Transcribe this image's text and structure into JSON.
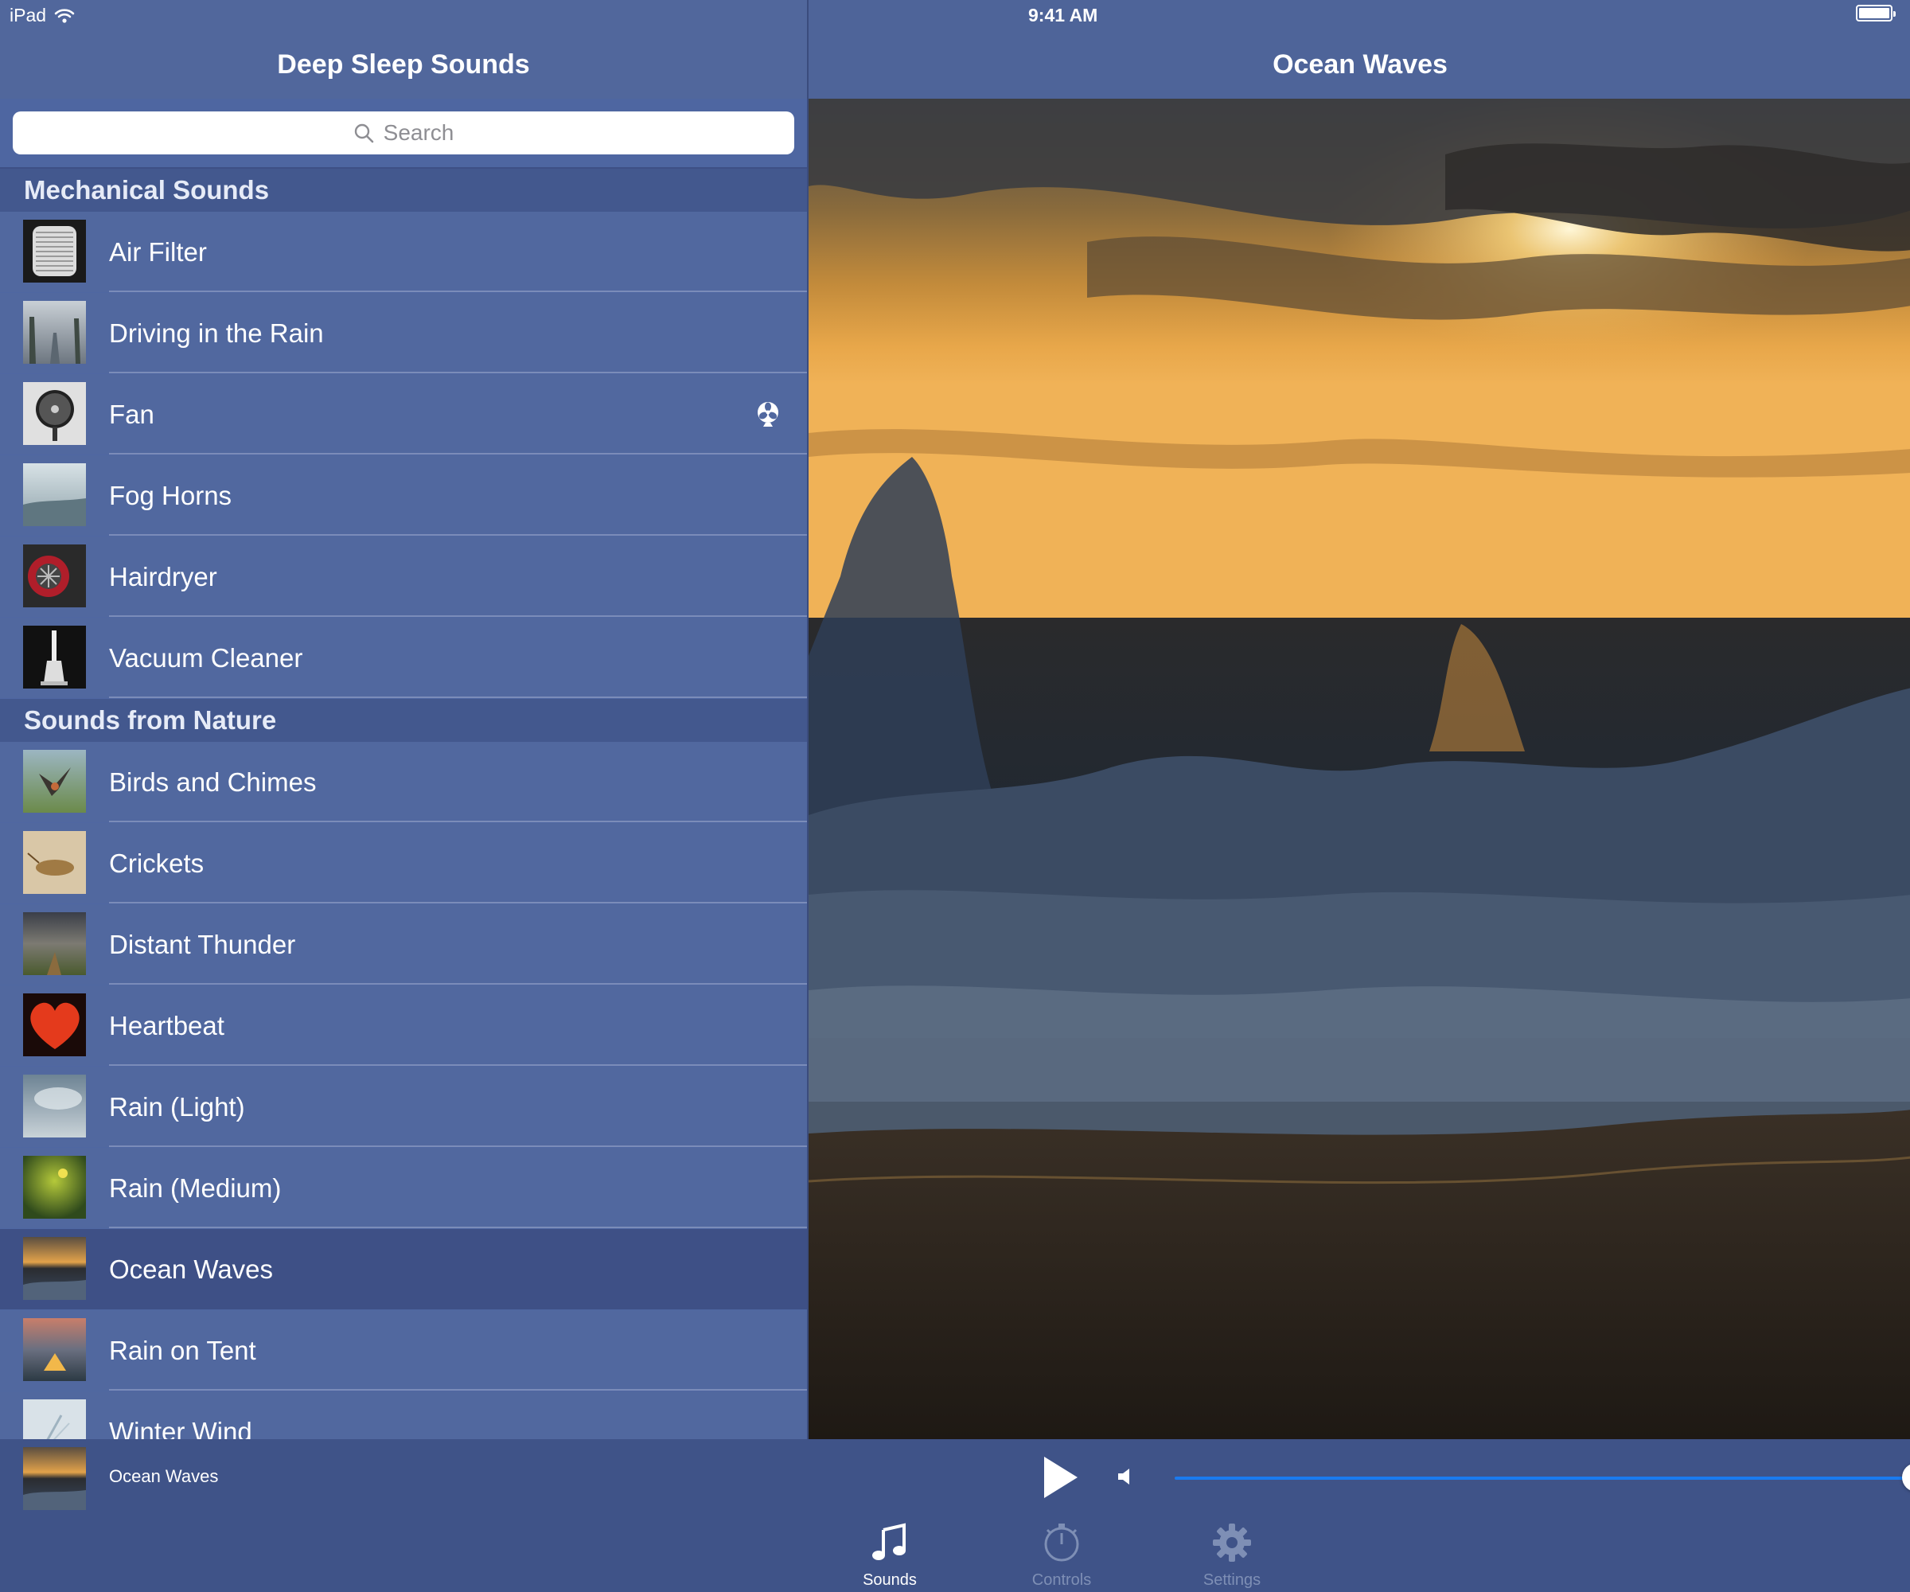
{
  "status_bar": {
    "carrier": "iPad",
    "time": "9:41 AM",
    "battery_level": 1.0
  },
  "master": {
    "title": "Deep Sleep Sounds",
    "search_placeholder": "Search",
    "sections": [
      {
        "header": "Mechanical Sounds",
        "items": [
          {
            "label": "Air Filter",
            "thumb": "air-filter"
          },
          {
            "label": "Driving in the Rain",
            "thumb": "driving-rain"
          },
          {
            "label": "Fan",
            "thumb": "fan",
            "accessory": "fan-icon"
          },
          {
            "label": "Fog Horns",
            "thumb": "fog-horns"
          },
          {
            "label": "Hairdryer",
            "thumb": "hairdryer"
          },
          {
            "label": "Vacuum Cleaner",
            "thumb": "vacuum"
          }
        ]
      },
      {
        "header": "Sounds from Nature",
        "items": [
          {
            "label": "Birds and Chimes",
            "thumb": "birds"
          },
          {
            "label": "Crickets",
            "thumb": "crickets"
          },
          {
            "label": "Distant Thunder",
            "thumb": "thunder"
          },
          {
            "label": "Heartbeat",
            "thumb": "heartbeat"
          },
          {
            "label": "Rain (Light)",
            "thumb": "rain-light"
          },
          {
            "label": "Rain (Medium)",
            "thumb": "rain-medium"
          },
          {
            "label": "Ocean Waves",
            "thumb": "ocean",
            "selected": true
          },
          {
            "label": "Rain on Tent",
            "thumb": "tent"
          },
          {
            "label": "Winter Wind",
            "thumb": "winter"
          }
        ]
      }
    ]
  },
  "detail": {
    "title": "Ocean Waves"
  },
  "player": {
    "now_playing": "Ocean Waves",
    "volume": 1.0
  },
  "tabs": [
    {
      "label": "Sounds",
      "icon": "music-note-icon",
      "active": true
    },
    {
      "label": "Controls",
      "icon": "stopwatch-icon",
      "active": false
    },
    {
      "label": "Settings",
      "icon": "gear-icon",
      "active": false
    }
  ],
  "colors": {
    "row": "#51689f",
    "row_selected": "#3e5086",
    "section_header": "#43588e",
    "player_bar": "#3f5388",
    "volume_track": "#1a7bf0"
  }
}
